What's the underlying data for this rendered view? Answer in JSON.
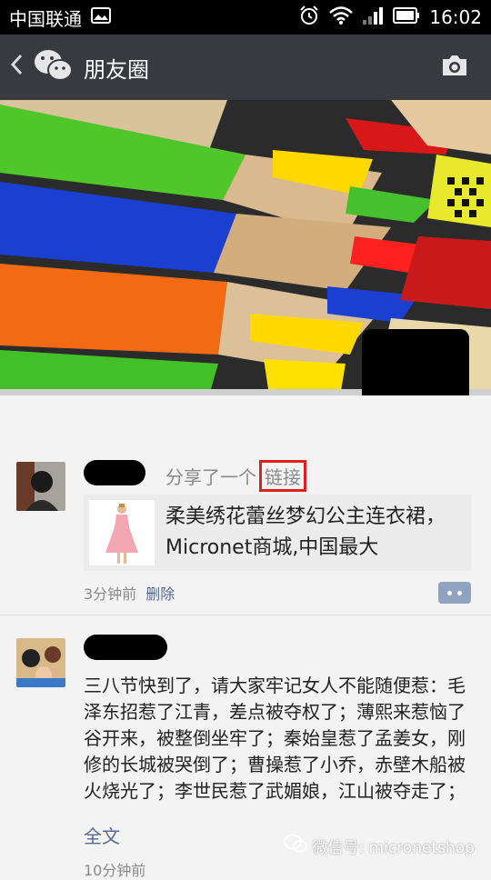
{
  "status_bar": {
    "carrier": "中国联通",
    "time": "16:02"
  },
  "header": {
    "title": "朋友圈",
    "icons": [
      "back-chevron-icon",
      "wechat-logo-icon",
      "camera-icon"
    ]
  },
  "posts": [
    {
      "action": "分享了一个",
      "link_word": "链接",
      "link_card_text": "柔美绣花蕾丝梦幻公主连衣裙，Micronet商城,中国最大",
      "time": "3分钟前",
      "delete_label": "删除"
    },
    {
      "text": "三八节快到了，请大家牢记女人不能随便惹：毛泽东招惹了江青，差点被夺权了；薄熙来惹恼了谷开来，被整倒坐牢了；秦始皇惹了孟姜女，刚修的长城被哭倒了；曹操惹了小乔，赤壁木船被火烧光了；李世民惹了武媚娘，江山被夺走了；咸丰惹了慈禧，清",
      "full_text_label": "全文",
      "time": "10分钟前"
    }
  ],
  "watermark": "微信号: micronetshop",
  "colors": {
    "header_bg": "#393a3f",
    "status_bg": "#000000",
    "link_blue": "#576b95",
    "highlight_red": "#e0201b"
  }
}
